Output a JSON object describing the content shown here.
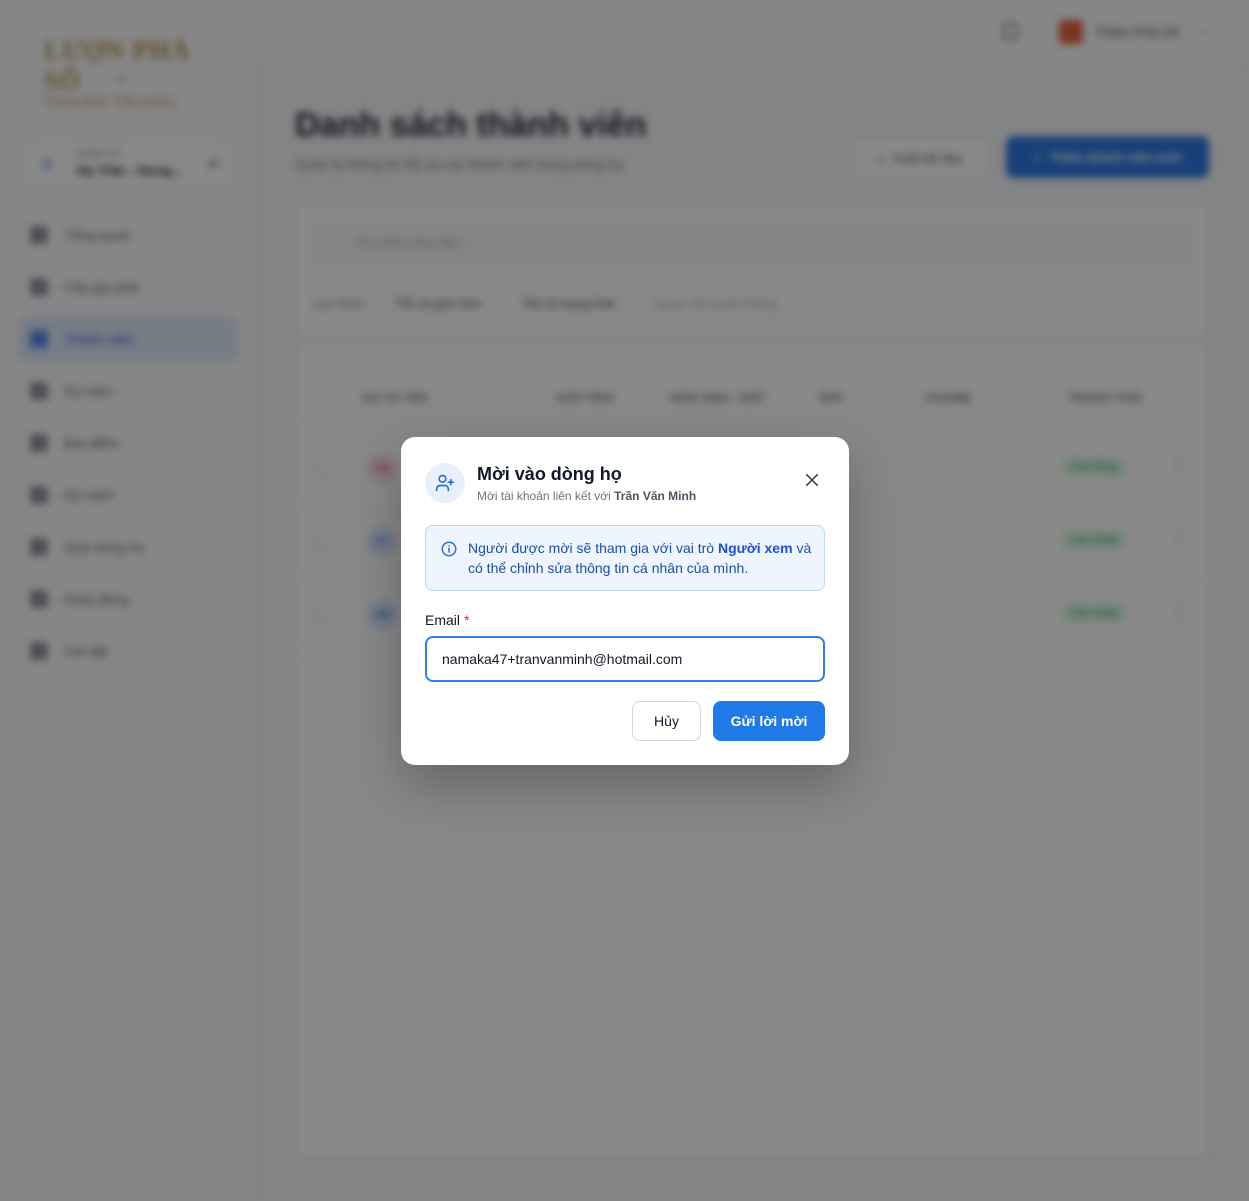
{
  "sidebar": {
    "logo_line1": "LƯỢN PHẢ SỐ",
    "logo_line2": "✦",
    "logo_line3": "THANH TRANG",
    "org_label": "DÒNG HỌ",
    "org_name": "Họ Trần - Hưng...",
    "items": [
      {
        "label": "Tổng quan"
      },
      {
        "label": "Cây gia phả"
      },
      {
        "label": "Thành viên"
      },
      {
        "label": "Sự kiện"
      },
      {
        "label": "Địa điểm"
      },
      {
        "label": "Kỷ niệm"
      },
      {
        "label": "Quỹ dòng họ"
      },
      {
        "label": "Hoạt động"
      },
      {
        "label": "Cài đặt"
      }
    ]
  },
  "topbar": {
    "user_name": "Thiên Phả Số"
  },
  "main": {
    "title": "Danh sách thành viên",
    "subtitle": "Quản lý thông tin tất cả các thành viên trong dòng họ",
    "export_label": "Xuất dữ liệu",
    "add_label": "Thêm thành viên mới",
    "search_placeholder": "Tìm kiếm theo tên...",
    "filter_label": "Lọc theo:",
    "filters": [
      "Tất cả giới tính",
      "Tất cả trạng thái",
      "Quan hệ huyết thống"
    ],
    "columns": [
      "HỌ VÀ TÊN",
      "GIỚI TÍNH",
      "NĂM SINH - MẤT",
      "ĐỜI",
      "CHA/MẸ",
      "TRẠNG THÁI"
    ],
    "rows": [
      {
        "initials": "TN",
        "status": "Còn sống"
      },
      {
        "initials": "VT",
        "status": "Còn sống"
      },
      {
        "initials": "VM",
        "status": "Còn sống"
      }
    ]
  },
  "modal": {
    "title": "Mời vào dòng họ",
    "subtitle_prefix": "Mời tài khoản liên kết với",
    "subtitle_name": "Trần Văn Minh",
    "info_prefix": "Người được mời sẽ tham gia với vai trò",
    "info_role": "Người xem",
    "info_suffix": "và có thể chỉnh sửa thông tin cá nhân của mình.",
    "email_label": "Email",
    "email_required": "*",
    "email_value": "namaka47+tranvanminh@hotmail.com",
    "cancel_label": "Hủy",
    "send_label": "Gửi lời mời"
  },
  "colors": {
    "primary": "#1f7ae8",
    "info_bg": "#eef5fe",
    "required": "#dc2626",
    "overlay": "rgba(17,17,17,0.5)"
  }
}
